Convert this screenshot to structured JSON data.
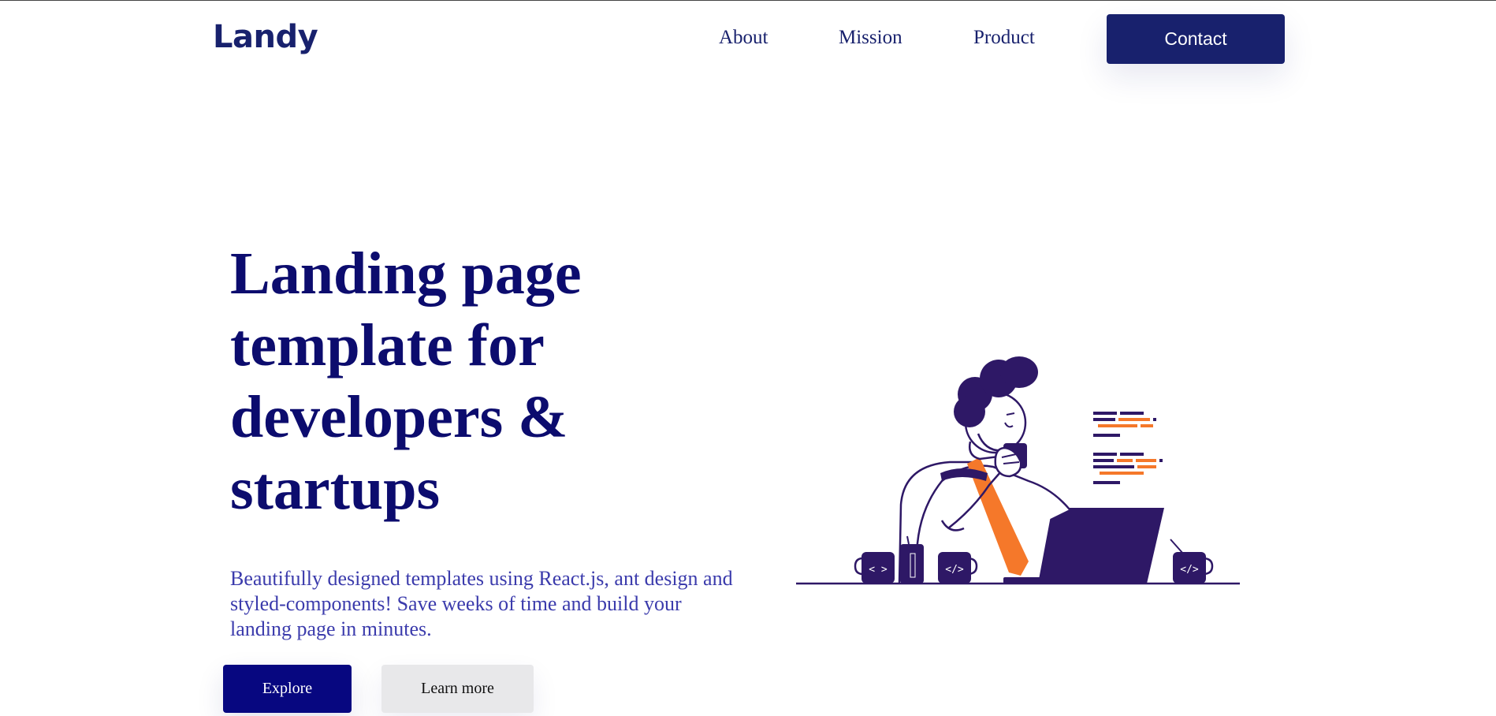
{
  "header": {
    "logo": "Landy",
    "nav": [
      {
        "label": "About"
      },
      {
        "label": "Mission"
      },
      {
        "label": "Product"
      }
    ],
    "contact_label": "Contact"
  },
  "hero": {
    "title_lines": [
      "Landing page",
      "template for",
      "developers &",
      "startups"
    ],
    "description": "Beautifully designed templates using React.js, ant design and styled-components! Save weeks of time and build your landing page in minutes.",
    "explore_label": "Explore",
    "learn_more_label": "Learn more"
  },
  "illustration": {
    "mug_labels": [
      "< >",
      "</>",
      "</>"
    ],
    "colors": {
      "navy": "#2e1866",
      "orange": "#f5782a",
      "ink": "#18216d"
    }
  }
}
